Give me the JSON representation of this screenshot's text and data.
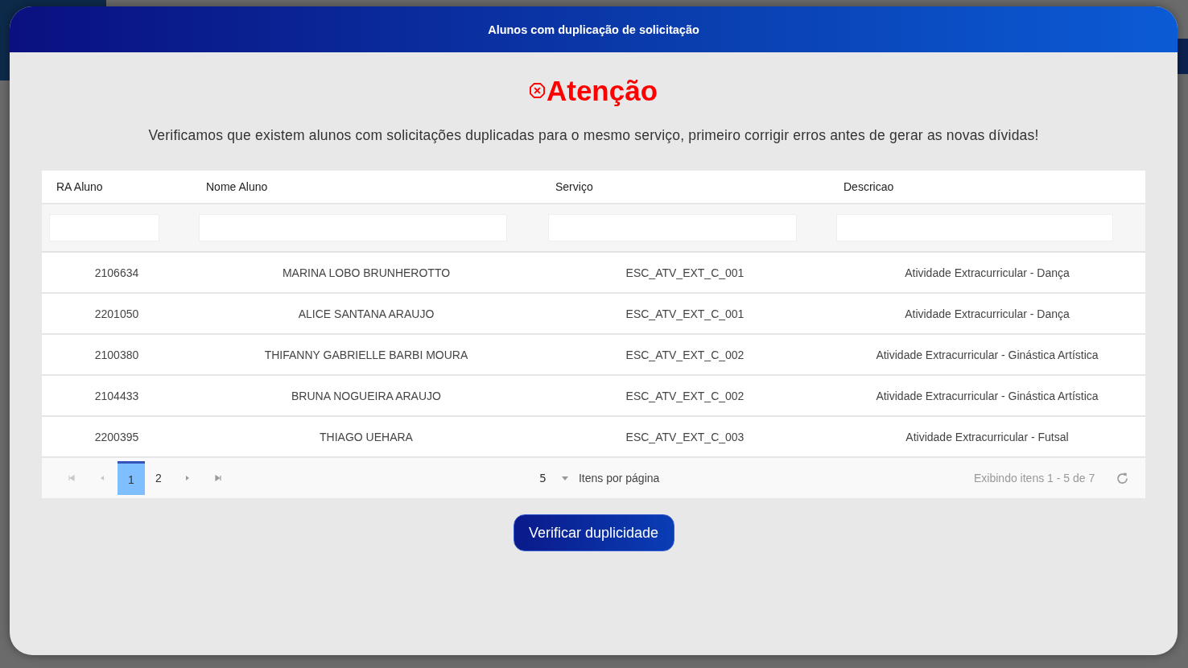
{
  "dialog": {
    "title": "Alunos com duplicação de solicitação"
  },
  "alert": {
    "heading": "Atenção",
    "message": "Verificamos que existem alunos com solicitações duplicadas para o mesmo serviço, primeiro corrigir erros antes de gerar as novas dívidas!"
  },
  "table": {
    "columns": [
      "RA Aluno",
      "Nome Aluno",
      "Serviço",
      "Descricao"
    ],
    "rows": [
      {
        "ra": "2106634",
        "nome": "MARINA LOBO BRUNHEROTTO",
        "servico": "ESC_ATV_EXT_C_001",
        "descricao": "Atividade Extracurricular - Dança"
      },
      {
        "ra": "2201050",
        "nome": "ALICE SANTANA ARAUJO",
        "servico": "ESC_ATV_EXT_C_001",
        "descricao": "Atividade Extracurricular - Dança"
      },
      {
        "ra": "2100380",
        "nome": "THIFANNY GABRIELLE BARBI MOURA",
        "servico": "ESC_ATV_EXT_C_002",
        "descricao": "Atividade Extracurricular - Ginástica Artística"
      },
      {
        "ra": "2104433",
        "nome": "BRUNA NOGUEIRA ARAUJO",
        "servico": "ESC_ATV_EXT_C_002",
        "descricao": "Atividade Extracurricular - Ginástica Artística"
      },
      {
        "ra": "2200395",
        "nome": "THIAGO UEHARA",
        "servico": "ESC_ATV_EXT_C_003",
        "descricao": "Atividade Extracurricular - Futsal"
      }
    ]
  },
  "pager": {
    "pages": [
      {
        "label": "1",
        "selected": true
      },
      {
        "label": "2",
        "selected": false
      }
    ],
    "page_size": "5",
    "page_size_label": "Itens por página",
    "summary": "Exibindo itens 1 - 5 de 7"
  },
  "button": "Verificar duplicidade"
}
